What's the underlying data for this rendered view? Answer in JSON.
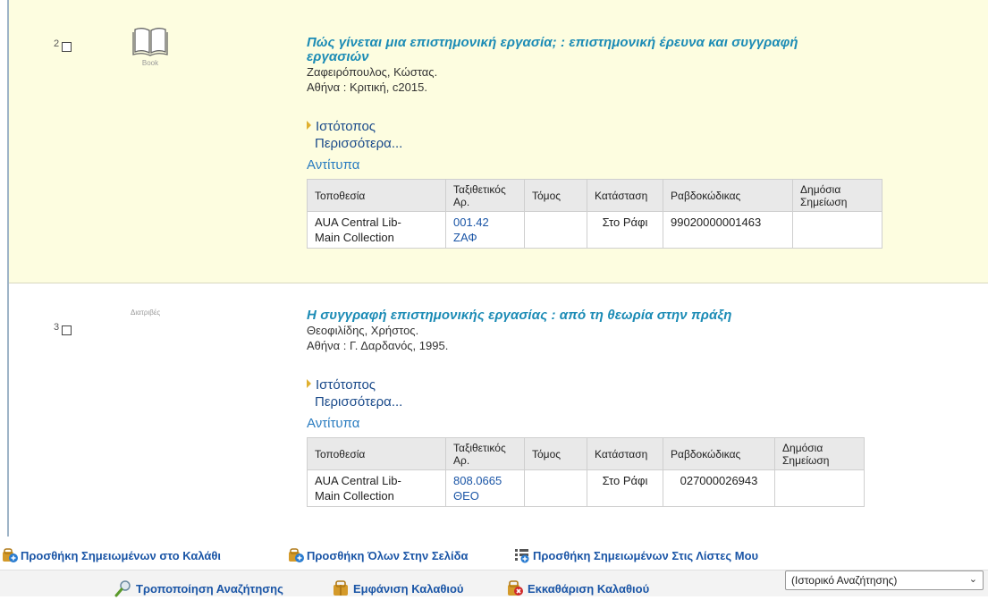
{
  "results": [
    {
      "number": "2",
      "format_label": "Book",
      "title_line1": "Πώς γίνεται μια επιστημονική εργασία; : επιστημονική έρευνα και συγγραφή",
      "title_line2": "εργασιών",
      "author": "Ζαφειρόπουλος, Κώστας.",
      "publication": "Αθήνα : Κριτική, c2015.",
      "website_label": "Ιστότοπος",
      "more_label": "Περισσότερα...",
      "copies_label": "Αντίτυπα",
      "holdings": {
        "headers": [
          "Τοποθεσία",
          "Ταξιθετικός Αρ.",
          "Τόμος",
          "Κατάσταση",
          "Ραβδοκώδικας",
          "Δημόσια Σημείωση"
        ],
        "row": {
          "location_line1": "AUA Central Lib-",
          "location_line2": "Main Collection",
          "call_line1": "001.42",
          "call_line2": "ΖΑΦ",
          "volume": "",
          "status": "Στο Ράφι",
          "barcode": "99020000001463",
          "note": ""
        }
      }
    },
    {
      "number": "3",
      "format_label": "Διατριβές",
      "title_line1": "Η συγγραφή επιστημονικής εργασίας : από τη θεωρία στην πράξη",
      "author": "Θεοφιλίδης, Χρήστος.",
      "publication": "Αθήνα : Γ. Δαρδανός, 1995.",
      "website_label": "Ιστότοπος",
      "more_label": "Περισσότερα...",
      "copies_label": "Αντίτυπα",
      "holdings": {
        "headers": [
          "Τοποθεσία",
          "Ταξιθετικός Αρ.",
          "Τόμος",
          "Κατάσταση",
          "Ραβδοκώδικας",
          "Δημόσια Σημείωση"
        ],
        "row": {
          "location_line1": "AUA Central Lib-",
          "location_line2": "Main Collection",
          "call_line1": "808.0665",
          "call_line2": "ΘΕΟ",
          "volume": "",
          "status": "Στο Ράφι",
          "barcode": "027000026943",
          "note": ""
        }
      }
    }
  ],
  "actions": {
    "add_marked_to_basket": "Προσθήκη Σημειωμένων στο Καλάθι",
    "add_all_on_page": "Προσθήκη Όλων Στην Σελίδα",
    "add_marked_to_lists": "Προσθήκη Σημειωμένων Στις Λίστες Μου"
  },
  "footer": {
    "modify_search": "Τροποποίηση Αναζήτησης",
    "show_basket": "Εμφάνιση Καλαθιού",
    "clear_basket": "Εκκαθάριση Καλαθιού",
    "history_selected": "(Ιστορικό Αναζήτησης)"
  },
  "icons": {
    "book": "book-icon",
    "basket_add": "basket-add-icon",
    "list_add": "list-add-icon",
    "search_edit": "search-edit-icon",
    "basket": "basket-icon",
    "basket_clear": "basket-clear-icon"
  },
  "colors": {
    "highlight_row": "#fdfde0",
    "title": "#1b8bb5",
    "link": "#1a55a6"
  }
}
